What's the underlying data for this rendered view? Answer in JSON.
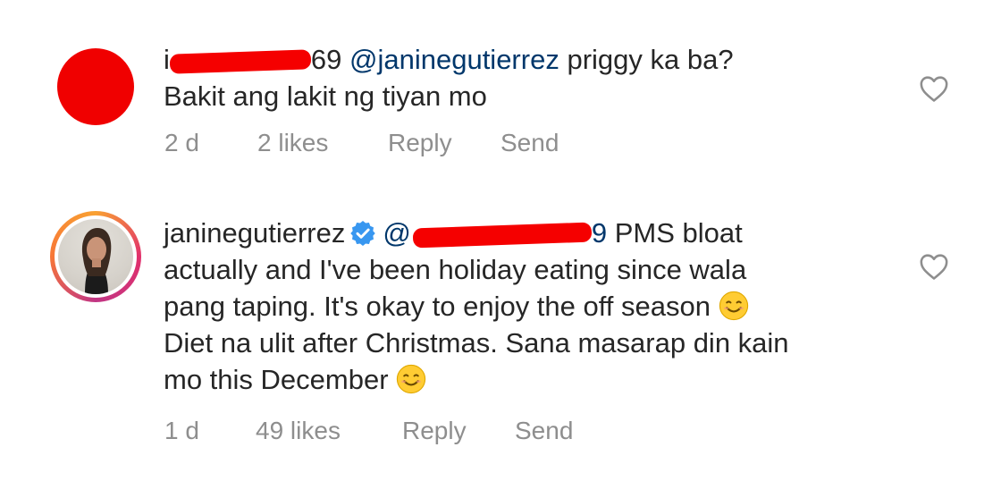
{
  "comments": [
    {
      "username_prefix": "i",
      "username_suffix": "69",
      "mention": "@janinegutierrez",
      "text_line1": "priggy ka ba?",
      "text_line2": "Bakit ang lakit ng tiyan mo",
      "time": "2 d",
      "likes": "2 likes",
      "reply": "Reply",
      "send": "Send",
      "avatar_color": "#f00000"
    },
    {
      "username": "janinegutierrez",
      "mention_prefix": "@",
      "mention_suffix": "9",
      "text_line1": "PMS bloat",
      "text_line2": "actually and I've been holiday eating since wala",
      "text_line3": "pang taping. It's okay to enjoy the off season",
      "text_line4": "Diet na ulit after Christmas. Sana masarap din kain",
      "text_line5": "mo this December",
      "time": "1 d",
      "likes": "49 likes",
      "reply": "Reply",
      "send": "Send"
    }
  ],
  "icons": {
    "like": "heart-outline-icon",
    "verified": "verified-badge-icon",
    "emoji": "smiling-face-emoji"
  },
  "colors": {
    "text": "#262626",
    "meta": "#8e8e8e",
    "mention": "#00376b",
    "verified": "#3897f0",
    "redaction": "#f50000"
  }
}
